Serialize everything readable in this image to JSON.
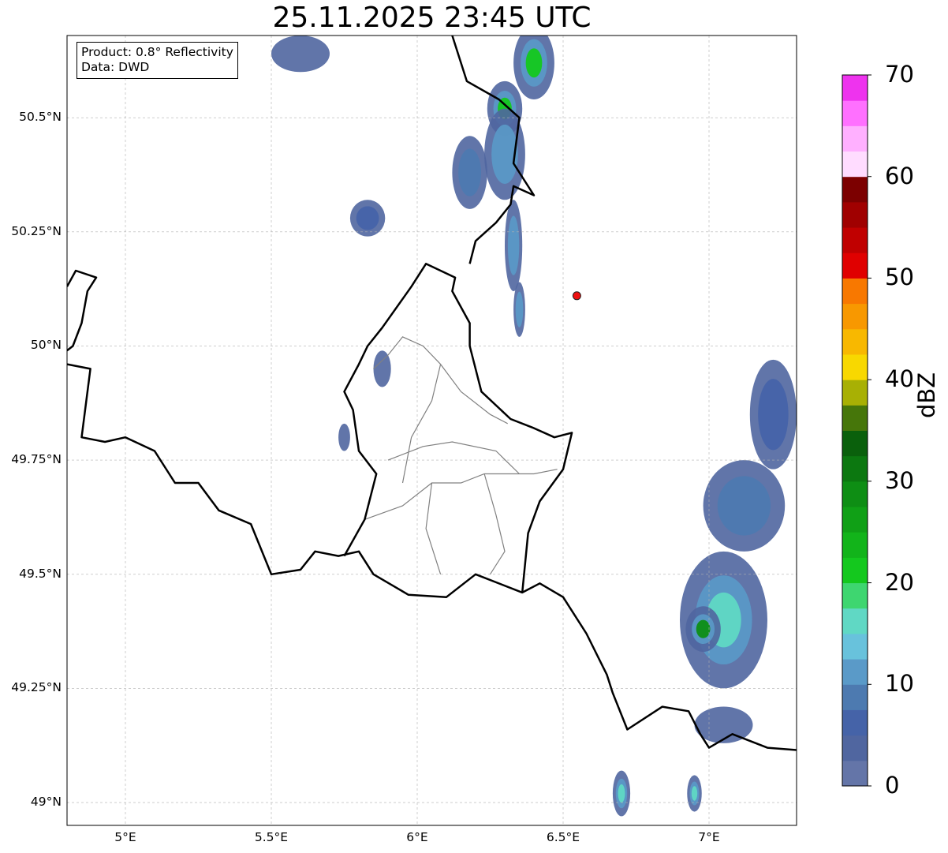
{
  "title": "25.11.2025 23:45 UTC",
  "info": {
    "product": "Product: 0.8° Reflectivity",
    "source": "Data: DWD"
  },
  "axes": {
    "lon_range": [
      4.8,
      7.3
    ],
    "lat_range": [
      48.95,
      50.68
    ],
    "lat_ticks": [
      {
        "value": 50.5,
        "label": "50.5°N"
      },
      {
        "value": 50.25,
        "label": "50.25°N"
      },
      {
        "value": 50.0,
        "label": "50°N"
      },
      {
        "value": 49.75,
        "label": "49.75°N"
      },
      {
        "value": 49.5,
        "label": "49.5°N"
      },
      {
        "value": 49.25,
        "label": "49.25°N"
      },
      {
        "value": 49.0,
        "label": "49°N"
      }
    ],
    "lon_ticks": [
      {
        "value": 5.0,
        "label": "5°E"
      },
      {
        "value": 5.5,
        "label": "5.5°E"
      },
      {
        "value": 6.0,
        "label": "6°E"
      },
      {
        "value": 6.5,
        "label": "6.5°E"
      },
      {
        "value": 7.0,
        "label": "7°E"
      }
    ],
    "grid": "dashed"
  },
  "colorbar": {
    "unit": "dBZ",
    "min": 0,
    "max": 70,
    "step": 2.5,
    "tick_labels": [
      "0",
      "10",
      "20",
      "30",
      "40",
      "50",
      "60",
      "70"
    ],
    "colors": [
      "#6475a8",
      "#5066a0",
      "#4563a8",
      "#4d7ab0",
      "#5a9ac8",
      "#68c2dc",
      "#60d8c4",
      "#3ed670",
      "#14c81e",
      "#12b41a",
      "#10a016",
      "#0e8e14",
      "#0c7810",
      "#0a600c",
      "#46760a",
      "#a8b004",
      "#f8d800",
      "#f8b800",
      "#f89800",
      "#f87800",
      "#e00000",
      "#c00000",
      "#a00000",
      "#7c0000",
      "#ffdcff",
      "#ffb0ff",
      "#ff70ff",
      "#ee33ee"
    ]
  },
  "site_marker": {
    "lon": 6.547,
    "lat": 50.11,
    "color": "#ee1111"
  },
  "borders": {
    "national": [
      [
        [
          4.8,
          50.13
        ],
        [
          4.83,
          50.165
        ],
        [
          4.9,
          50.15
        ],
        [
          4.87,
          50.12
        ],
        [
          4.85,
          50.05
        ],
        [
          4.82,
          50.0
        ],
        [
          4.8,
          49.99
        ]
      ],
      [
        [
          4.8,
          49.96
        ],
        [
          4.88,
          49.95
        ],
        [
          4.85,
          49.8
        ],
        [
          4.93,
          49.79
        ],
        [
          5.0,
          49.8
        ],
        [
          5.1,
          49.77
        ],
        [
          5.17,
          49.7
        ],
        [
          5.25,
          49.7
        ],
        [
          5.32,
          49.64
        ],
        [
          5.43,
          49.61
        ],
        [
          5.5,
          49.5
        ],
        [
          5.6,
          49.51
        ],
        [
          5.65,
          49.55
        ],
        [
          5.73,
          49.54
        ],
        [
          5.8,
          49.55
        ],
        [
          5.85,
          49.5
        ],
        [
          5.97,
          49.455
        ],
        [
          6.1,
          49.45
        ],
        [
          6.2,
          49.5
        ],
        [
          6.36,
          49.46
        ],
        [
          6.42,
          49.48
        ],
        [
          6.5,
          49.45
        ],
        [
          6.58,
          49.37
        ],
        [
          6.65,
          49.28
        ],
        [
          6.67,
          49.24
        ],
        [
          6.72,
          49.16
        ],
        [
          6.84,
          49.21
        ],
        [
          6.93,
          49.2
        ],
        [
          6.97,
          49.15
        ],
        [
          7.0,
          49.12
        ],
        [
          7.08,
          49.15
        ],
        [
          7.2,
          49.12
        ],
        [
          7.3,
          49.115
        ]
      ],
      [
        [
          5.75,
          49.54
        ],
        [
          5.82,
          49.62
        ],
        [
          5.86,
          49.72
        ],
        [
          5.8,
          49.77
        ],
        [
          5.78,
          49.86
        ],
        [
          5.75,
          49.9
        ],
        [
          5.8,
          49.96
        ],
        [
          5.83,
          50.0
        ],
        [
          5.88,
          50.04
        ],
        [
          5.98,
          50.13
        ],
        [
          6.03,
          50.18
        ],
        [
          6.13,
          50.15
        ],
        [
          6.12,
          50.12
        ],
        [
          6.18,
          50.05
        ],
        [
          6.18,
          50.0
        ],
        [
          6.22,
          49.9
        ],
        [
          6.32,
          49.84
        ],
        [
          6.4,
          49.82
        ],
        [
          6.47,
          49.8
        ],
        [
          6.53,
          49.81
        ],
        [
          6.5,
          49.73
        ],
        [
          6.42,
          49.66
        ],
        [
          6.38,
          49.59
        ],
        [
          6.36,
          49.46
        ]
      ],
      [
        [
          6.18,
          50.18
        ],
        [
          6.2,
          50.23
        ],
        [
          6.27,
          50.27
        ],
        [
          6.32,
          50.31
        ],
        [
          6.33,
          50.35
        ],
        [
          6.4,
          50.33
        ],
        [
          6.33,
          50.4
        ],
        [
          6.35,
          50.5
        ],
        [
          6.28,
          50.54
        ],
        [
          6.17,
          50.58
        ],
        [
          6.12,
          50.68
        ]
      ]
    ],
    "regional": [
      [
        [
          5.85,
          49.95
        ],
        [
          5.9,
          49.98
        ],
        [
          5.95,
          50.02
        ],
        [
          6.02,
          50.0
        ],
        [
          6.08,
          49.96
        ]
      ],
      [
        [
          6.08,
          49.96
        ],
        [
          6.15,
          49.9
        ],
        [
          6.25,
          49.85
        ],
        [
          6.31,
          49.83
        ]
      ],
      [
        [
          6.08,
          49.96
        ],
        [
          6.05,
          49.88
        ],
        [
          5.98,
          49.8
        ],
        [
          5.95,
          49.7
        ]
      ],
      [
        [
          5.82,
          49.62
        ],
        [
          5.95,
          49.65
        ],
        [
          6.05,
          49.7
        ],
        [
          6.15,
          49.7
        ],
        [
          6.23,
          49.72
        ],
        [
          6.4,
          49.72
        ],
        [
          6.48,
          49.73
        ]
      ],
      [
        [
          6.05,
          49.7
        ],
        [
          6.03,
          49.6
        ],
        [
          6.08,
          49.5
        ]
      ],
      [
        [
          6.23,
          49.72
        ],
        [
          6.27,
          49.63
        ],
        [
          6.3,
          49.55
        ],
        [
          6.25,
          49.5
        ]
      ],
      [
        [
          5.9,
          49.75
        ],
        [
          6.02,
          49.78
        ],
        [
          6.12,
          49.79
        ],
        [
          6.27,
          49.77
        ],
        [
          6.35,
          49.72
        ]
      ]
    ]
  },
  "precip_cells": [
    {
      "lon": 6.4,
      "lat": 50.62,
      "rx": 0.07,
      "ry": 0.08,
      "dbz": 20
    },
    {
      "lon": 6.3,
      "lat": 50.52,
      "rx": 0.06,
      "ry": 0.06,
      "dbz": 22
    },
    {
      "lon": 6.3,
      "lat": 50.42,
      "rx": 0.07,
      "ry": 0.1,
      "dbz": 10
    },
    {
      "lon": 6.18,
      "lat": 50.38,
      "rx": 0.06,
      "ry": 0.08,
      "dbz": 8
    },
    {
      "lon": 6.33,
      "lat": 50.22,
      "rx": 0.03,
      "ry": 0.1,
      "dbz": 12
    },
    {
      "lon": 6.35,
      "lat": 50.08,
      "rx": 0.02,
      "ry": 0.06,
      "dbz": 10
    },
    {
      "lon": 5.6,
      "lat": 50.64,
      "rx": 0.1,
      "ry": 0.04,
      "dbz": 6
    },
    {
      "lon": 5.83,
      "lat": 50.28,
      "rx": 0.06,
      "ry": 0.04,
      "dbz": 7
    },
    {
      "lon": 5.88,
      "lat": 49.95,
      "rx": 0.03,
      "ry": 0.04,
      "dbz": 6
    },
    {
      "lon": 5.75,
      "lat": 49.8,
      "rx": 0.02,
      "ry": 0.03,
      "dbz": 6
    },
    {
      "lon": 7.05,
      "lat": 49.4,
      "rx": 0.15,
      "ry": 0.15,
      "dbz": 15
    },
    {
      "lon": 7.12,
      "lat": 49.65,
      "rx": 0.14,
      "ry": 0.1,
      "dbz": 8
    },
    {
      "lon": 7.22,
      "lat": 49.85,
      "rx": 0.08,
      "ry": 0.12,
      "dbz": 7
    },
    {
      "lon": 6.98,
      "lat": 49.38,
      "rx": 0.06,
      "ry": 0.05,
      "dbz": 28
    },
    {
      "lon": 7.05,
      "lat": 49.17,
      "rx": 0.1,
      "ry": 0.04,
      "dbz": 6
    },
    {
      "lon": 6.7,
      "lat": 49.02,
      "rx": 0.03,
      "ry": 0.05,
      "dbz": 16
    },
    {
      "lon": 6.95,
      "lat": 49.02,
      "rx": 0.025,
      "ry": 0.04,
      "dbz": 16
    }
  ]
}
